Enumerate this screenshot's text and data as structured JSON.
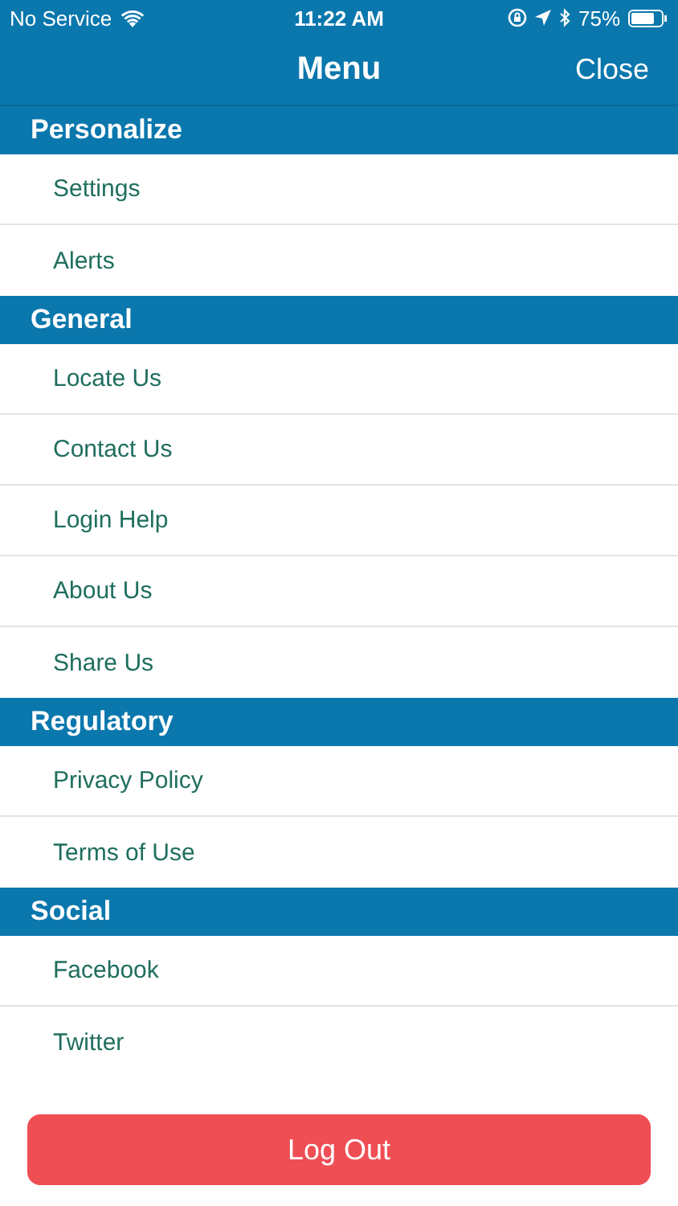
{
  "status_bar": {
    "carrier": "No Service",
    "time": "11:22 AM",
    "battery": "75%"
  },
  "nav_bar": {
    "title": "Menu",
    "close": "Close"
  },
  "sections": [
    {
      "title": "Personalize",
      "items": [
        "Settings",
        "Alerts"
      ]
    },
    {
      "title": "General",
      "items": [
        "Locate Us",
        "Contact Us",
        "Login Help",
        "About Us",
        "Share Us"
      ]
    },
    {
      "title": "Regulatory",
      "items": [
        "Privacy Policy",
        "Terms of Use"
      ]
    },
    {
      "title": "Social",
      "items": [
        "Facebook",
        "Twitter"
      ]
    }
  ],
  "logout_button": "Log Out"
}
